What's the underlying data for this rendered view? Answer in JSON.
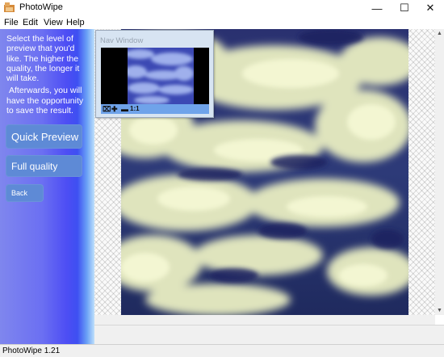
{
  "window": {
    "title": "PhotoWipe",
    "controls": {
      "minimize": "—",
      "maximize": "☐",
      "close": "✕"
    }
  },
  "menu": {
    "file": "File",
    "edit": "Edit",
    "view": "View",
    "help": "Help"
  },
  "sidebar": {
    "instruction_1": "Select the level of preview that you'd like. The higher the quality, the longer it will take.",
    "instruction_2": "Afterwards, you will have the opportunity to save the result.",
    "quick_preview": "Quick Preview",
    "full_quality": "Full quality",
    "back": "Back"
  },
  "nav_window": {
    "title": "Nav Window",
    "icons": [
      "fit-icon",
      "zoom-in-icon",
      "zoom-out-icon",
      "actual-size-icon"
    ],
    "actual_size_label": "1:1"
  },
  "status": {
    "text": "PhotoWipe 1.21"
  },
  "colors": {
    "sidebar_button": "#5e8ad6",
    "nav_bar": "#6fa3ea",
    "sky_dark": "#232b6a",
    "cloud_light": "#eef2c6"
  }
}
